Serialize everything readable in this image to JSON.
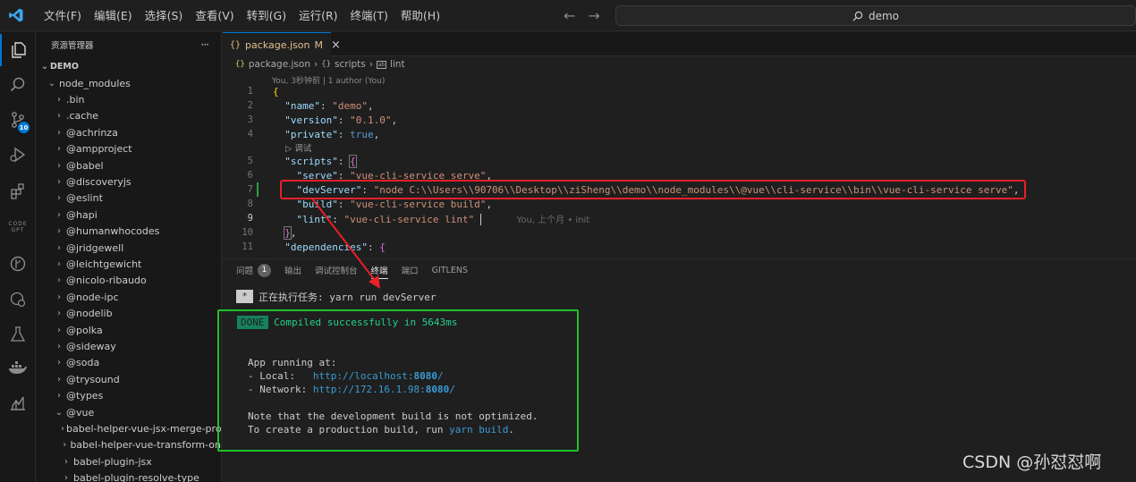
{
  "menu": {
    "items": [
      "文件(F)",
      "编辑(E)",
      "选择(S)",
      "查看(V)",
      "转到(G)",
      "运行(R)",
      "终端(T)",
      "帮助(H)"
    ]
  },
  "command_center": {
    "label": "demo"
  },
  "activity": {
    "scm_badge": "10",
    "gpt_label": "CODE GPT"
  },
  "sidebar": {
    "title": "资源管理器",
    "more": "···",
    "root": "DEMO",
    "items": [
      {
        "label": "node_modules",
        "open": true,
        "level": 1
      },
      {
        "label": ".bin",
        "open": false,
        "level": 2
      },
      {
        "label": ".cache",
        "open": false,
        "level": 2
      },
      {
        "label": "@achrinza",
        "open": false,
        "level": 2
      },
      {
        "label": "@ampproject",
        "open": false,
        "level": 2
      },
      {
        "label": "@babel",
        "open": false,
        "level": 2
      },
      {
        "label": "@discoveryjs",
        "open": false,
        "level": 2
      },
      {
        "label": "@eslint",
        "open": false,
        "level": 2
      },
      {
        "label": "@hapi",
        "open": false,
        "level": 2
      },
      {
        "label": "@humanwhocodes",
        "open": false,
        "level": 2
      },
      {
        "label": "@jridgewell",
        "open": false,
        "level": 2
      },
      {
        "label": "@leichtgewicht",
        "open": false,
        "level": 2
      },
      {
        "label": "@nicolo-ribaudo",
        "open": false,
        "level": 2
      },
      {
        "label": "@node-ipc",
        "open": false,
        "level": 2
      },
      {
        "label": "@nodelib",
        "open": false,
        "level": 2
      },
      {
        "label": "@polka",
        "open": false,
        "level": 2
      },
      {
        "label": "@sideway",
        "open": false,
        "level": 2
      },
      {
        "label": "@soda",
        "open": false,
        "level": 2
      },
      {
        "label": "@trysound",
        "open": false,
        "level": 2
      },
      {
        "label": "@types",
        "open": false,
        "level": 2
      },
      {
        "label": "@vue",
        "open": true,
        "level": 2
      },
      {
        "label": "babel-helper-vue-jsx-merge-pro...",
        "open": false,
        "level": 3
      },
      {
        "label": "babel-helper-vue-transform-on",
        "open": false,
        "level": 3
      },
      {
        "label": "babel-plugin-jsx",
        "open": false,
        "level": 3
      },
      {
        "label": "babel-plugin-resolve-type",
        "open": false,
        "level": 3
      }
    ]
  },
  "editor": {
    "tab": {
      "name": "package.json",
      "status": "M",
      "close": "×"
    },
    "breadcrumb": {
      "file": "package.json",
      "section": "scripts",
      "item": "lint"
    },
    "blame": "You, 3秒钟前 | 1 author (You)",
    "codelens_debug": "调试",
    "ghost_blame": "You, 上个月 • init",
    "lines": {
      "l1": "1",
      "l2": "2",
      "l3": "3",
      "l4": "4",
      "l5": "5",
      "l6": "6",
      "l7": "7",
      "l8": "8",
      "l9": "9",
      "l10": "10",
      "l11": "11"
    },
    "code": {
      "name_key": "\"name\"",
      "name_val": "\"demo\"",
      "version_key": "\"version\"",
      "version_val": "\"0.1.0\"",
      "private_key": "\"private\"",
      "private_val": "true",
      "scripts_key": "\"scripts\"",
      "serve_key": "\"serve\"",
      "serve_val": "\"vue-cli-service serve\"",
      "dev_key": "\"devServer\"",
      "dev_val": "\"node C:\\\\Users\\\\90706\\\\Desktop\\\\ziSheng\\\\demo\\\\node_modules\\\\@vue\\\\cli-service\\\\bin\\\\vue-cli-service serve\"",
      "build_key": "\"build\"",
      "build_val": "\"vue-cli-service build\"",
      "lint_key": "\"lint\"",
      "lint_val": "\"vue-cli-service lint\"",
      "deps_key": "\"dependencies\""
    }
  },
  "panel": {
    "tabs": [
      "问题",
      "输出",
      "调试控制台",
      "终端",
      "端口",
      "GITLENS"
    ],
    "problems_count": "1",
    "active_tab": "终端"
  },
  "terminal": {
    "task_marker": "*",
    "task_line": "正在执行任务: yarn run devServer",
    "done_badge": "DONE",
    "compiled": "Compiled successfully in 5643ms",
    "app_running": "App running at:",
    "local_label": "- Local:   ",
    "local_url_host": "http://localhost:",
    "local_url_port": "8080",
    "local_url_tail": "/",
    "network_label": "- Network: ",
    "network_url_host": "http://172.16.1.98:",
    "network_url_port": "8080",
    "network_url_tail": "/",
    "note": "Note that the development build is not optimized.",
    "prod_prefix": "To create a production build, run ",
    "prod_cmd": "yarn build",
    "prod_suffix": "."
  },
  "watermark": "CSDN @孙怼怼啊",
  "colors": {
    "accent": "#0078d4",
    "annotation_red": "#e8202a",
    "annotation_green": "#1fc02c",
    "done_green": "#16825d"
  }
}
